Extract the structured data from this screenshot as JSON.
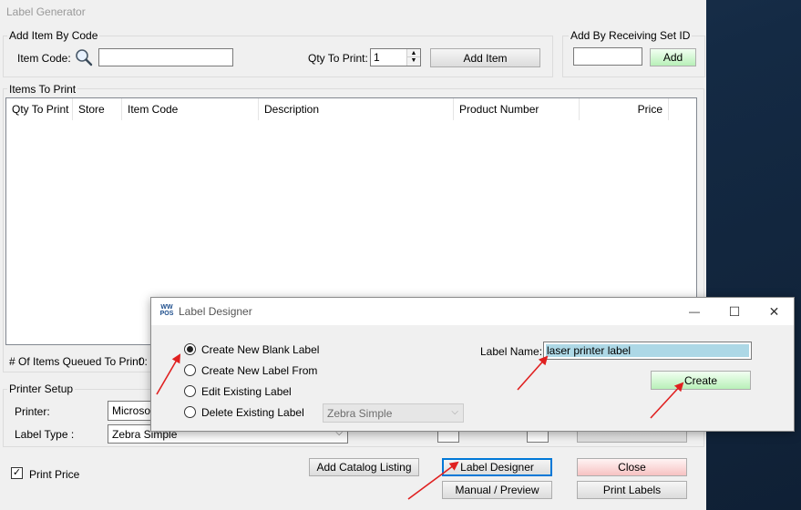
{
  "window": {
    "title": "Label Generator"
  },
  "add_by_code": {
    "group_label": "Add Item By Code",
    "item_code_label": "Item Code:",
    "item_code_value": "",
    "qty_label": "Qty To Print:",
    "qty_value": "1",
    "add_item_label": "Add Item"
  },
  "add_by_receiving": {
    "group_label": "Add By Receiving Set ID",
    "input_value": "",
    "add_label": "Add"
  },
  "items": {
    "group_label": "Items To Print",
    "columns": [
      "Qty To Print",
      "Store",
      "Item Code",
      "Description",
      "Product Number",
      "Price"
    ],
    "queued_label": "# Of Items Queued To Print :",
    "queued_count": "0"
  },
  "printer_setup": {
    "group_label": "Printer Setup",
    "printer_label": "Printer:",
    "printer_value": "Microsoft",
    "label_type_label": "Label Type :",
    "label_type_value": "Zebra Simple"
  },
  "footer": {
    "print_price_label": "Print Price",
    "print_price_checked": true,
    "add_catalog_label": "Add Catalog Listing",
    "label_designer_label": "Label Designer",
    "manual_preview_label": "Manual / Preview",
    "close_label": "Close",
    "print_labels_label": "Print Labels"
  },
  "dialog": {
    "title": "Label Designer",
    "logo_text": "WW POS",
    "options": [
      "Create New Blank Label",
      "Create New Label From",
      "Edit Existing Label",
      "Delete Existing Label"
    ],
    "selected_option": 0,
    "existing_label_value": "Zebra Simple",
    "label_name_label": "Label Name:",
    "label_name_value": "laser printer label",
    "create_label": "Create",
    "minimize_glyph": "—",
    "maximize_glyph": "☐",
    "close_glyph": "✕"
  },
  "colors": {
    "accent": "#0078d7",
    "annotation_arrow": "#e02020",
    "selection_highlight": "#add8e6"
  }
}
